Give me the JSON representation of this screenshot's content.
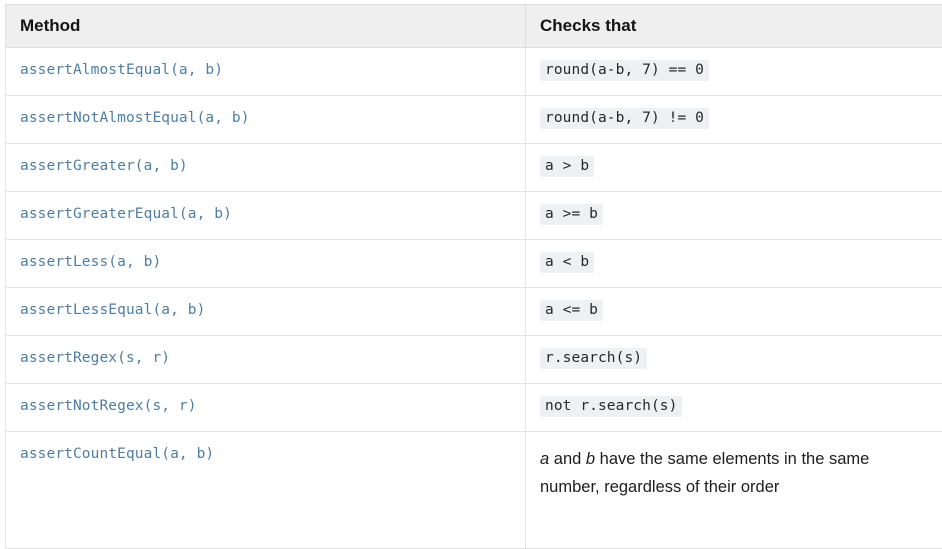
{
  "table": {
    "columns": [
      {
        "id": "method",
        "label": "Method"
      },
      {
        "id": "checks",
        "label": "Checks that"
      }
    ],
    "rows": [
      {
        "method": "assertAlmostEqual(a, b)",
        "checks": "round(a-b, 7) == 0",
        "checks_kind": "code"
      },
      {
        "method": "assertNotAlmostEqual(a, b)",
        "checks": "round(a-b, 7) != 0",
        "checks_kind": "code"
      },
      {
        "method": "assertGreater(a, b)",
        "checks": "a > b",
        "checks_kind": "code"
      },
      {
        "method": "assertGreaterEqual(a, b)",
        "checks": "a >= b",
        "checks_kind": "code"
      },
      {
        "method": "assertLess(a, b)",
        "checks": "a < b",
        "checks_kind": "code"
      },
      {
        "method": "assertLessEqual(a, b)",
        "checks": "a <= b",
        "checks_kind": "code"
      },
      {
        "method": "assertRegex(s, r)",
        "checks": "r.search(s)",
        "checks_kind": "code"
      },
      {
        "method": "assertNotRegex(s, r)",
        "checks": "not r.search(s)",
        "checks_kind": "code"
      },
      {
        "method": "assertCountEqual(a, b)",
        "checks_kind": "prose",
        "checks_prose": {
          "var1": "a",
          "middle": " and ",
          "var2": "b",
          "rest": " have the same elements in the same number, regardless of their order"
        }
      }
    ]
  },
  "colors": {
    "method_text": "#4f7da4",
    "code_bg": "#eef0f3",
    "code_text": "#26282b",
    "header_bg": "#efefef",
    "border": "#e4e4e4"
  }
}
